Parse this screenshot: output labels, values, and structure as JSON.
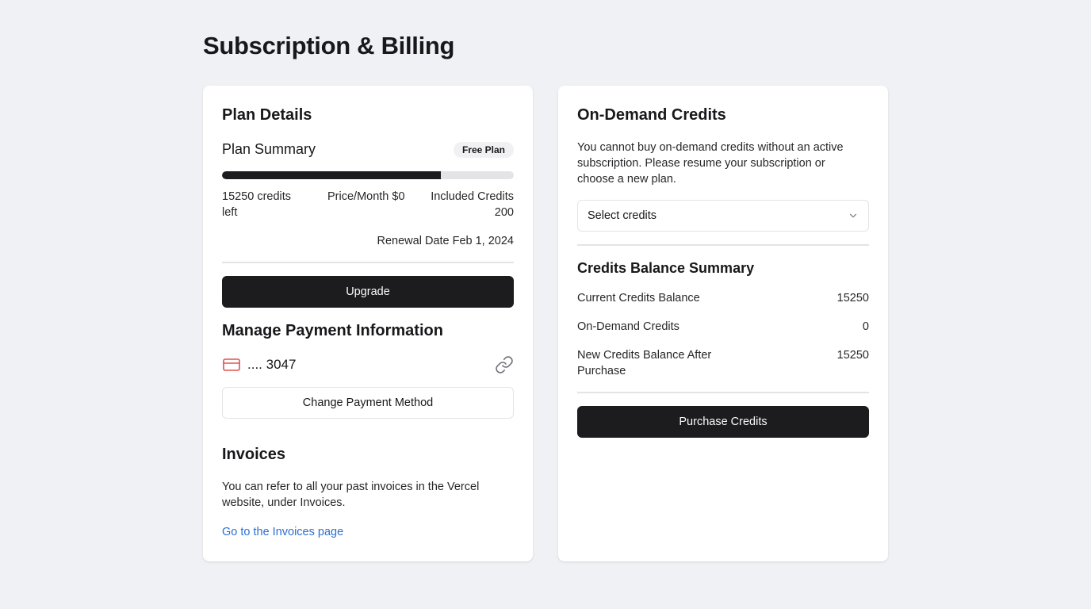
{
  "page": {
    "title": "Subscription & Billing"
  },
  "plan_details": {
    "title": "Plan Details",
    "summary_title": "Plan Summary",
    "badge": "Free Plan",
    "progress_fraction": 0.75,
    "credits_left": "15250 credits left",
    "price_month": "Price/Month $0",
    "included_credits": "Included Credits 200",
    "renewal": "Renewal Date Feb 1, 2024",
    "upgrade_label": "Upgrade"
  },
  "payment": {
    "title": "Manage Payment Information",
    "card_icon": "credit-card-icon",
    "card_masked": ".... 3047",
    "link_icon": "link-icon",
    "change_label": "Change Payment Method",
    "card_icon_color": "#e05252"
  },
  "invoices": {
    "title": "Invoices",
    "description": "You can refer to all your past invoices in the Vercel website, under Invoices.",
    "link_label": "Go to the Invoices page"
  },
  "on_demand": {
    "title": "On-Demand Credits",
    "description": "You cannot buy on-demand credits without an active subscription. Please resume your subscription or choose a new plan.",
    "select_placeholder": "Select credits",
    "select_icon": "chevron-down-icon"
  },
  "balance": {
    "title": "Credits Balance Summary",
    "rows": [
      {
        "label": "Current Credits Balance",
        "value": "15250"
      },
      {
        "label": "On-Demand Credits",
        "value": "0"
      },
      {
        "label": "New Credits Balance After Purchase",
        "value": "15250"
      }
    ],
    "purchase_label": "Purchase Credits"
  },
  "colors": {
    "background": "#f0f1f4",
    "card": "#ffffff",
    "dark_button": "#1c1c1f",
    "link": "#2a6fd6"
  }
}
